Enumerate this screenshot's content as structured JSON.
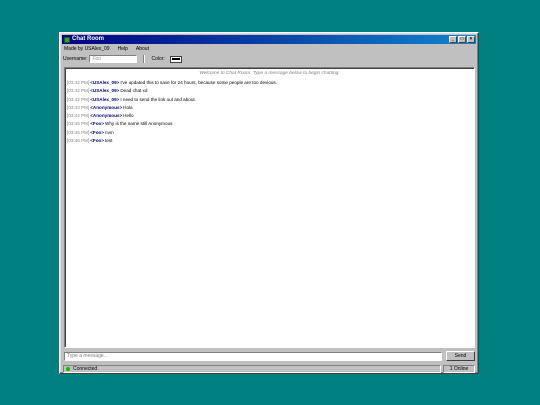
{
  "window": {
    "title": "Chat Room",
    "buttons": [
      "_",
      "□",
      "×"
    ]
  },
  "menu": [
    "Made by USAlex_09",
    "Help",
    "About"
  ],
  "toolbar": {
    "username_label": "Username:",
    "username_placeholder": "Foo",
    "color_label": "Color:",
    "color_value": "#000000"
  },
  "chat": {
    "welcome": "Welcome to Chat Room. Type a message below to begin chatting.",
    "messages": [
      {
        "time": "[03:42 PM]",
        "user": "<USAlex_09>",
        "text": "I've updated this to save for 24 hours, because some people are too devious."
      },
      {
        "time": "[03:42 PM]",
        "user": "<USAlex_09>",
        "text": "Dead chat xd"
      },
      {
        "time": "[03:42 PM]",
        "user": "<USAlex_09>",
        "text": "I need to send the link out and about."
      },
      {
        "time": "[03:43 PM]",
        "user": "<Anonymous>",
        "text": "Hola"
      },
      {
        "time": "[03:44 PM]",
        "user": "<Anonymous>",
        "text": "Hello"
      },
      {
        "time": "[03:45 PM]",
        "user": "<Foo>",
        "text": "Why is the name still Anonymous"
      },
      {
        "time": "[03:45 PM]",
        "user": "<Foo>",
        "text": "nvm"
      },
      {
        "time": "[03:46 PM]",
        "user": "<Foo>",
        "text": "test"
      }
    ]
  },
  "composer": {
    "placeholder": "Type a message...",
    "send_label": "Send"
  },
  "status": {
    "connection": "Connected",
    "online": "1 Online",
    "connected_color": "#00c000"
  }
}
